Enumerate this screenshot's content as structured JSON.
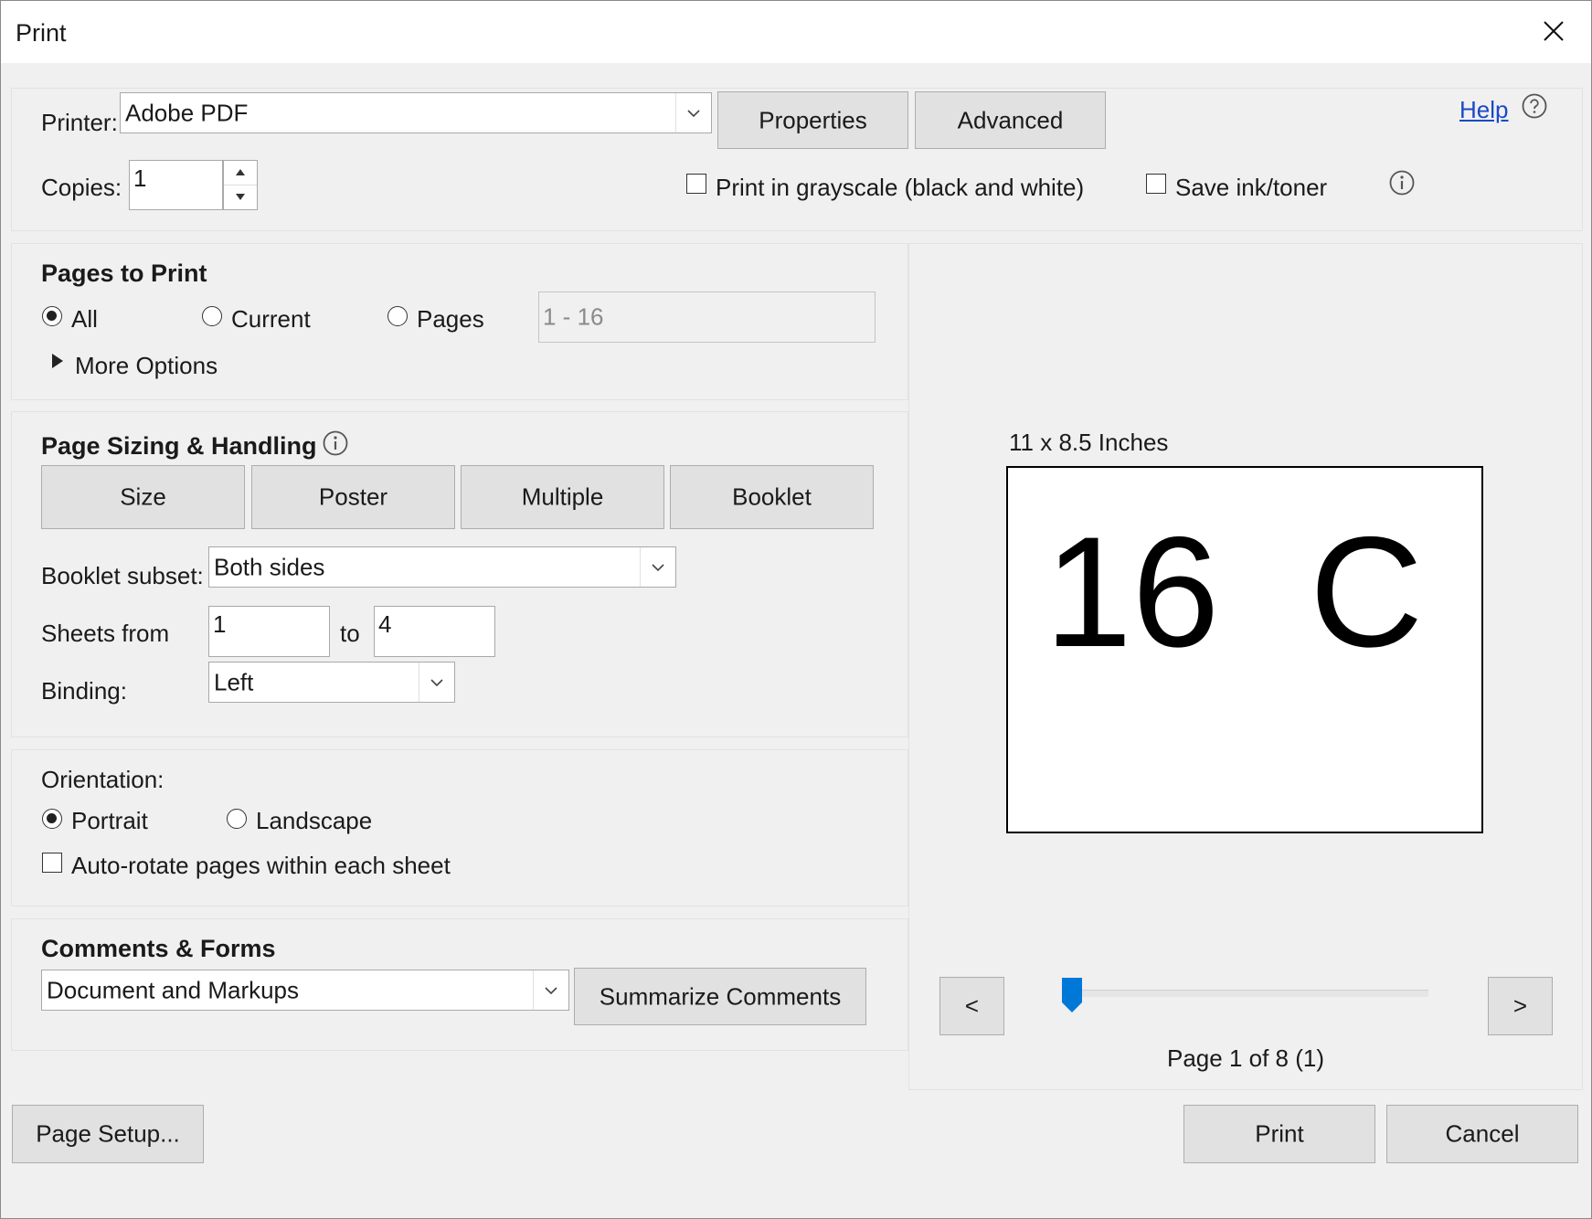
{
  "window": {
    "title": "Print"
  },
  "printer": {
    "label": "Printer:",
    "selected": "Adobe PDF",
    "properties_label": "Properties",
    "advanced_label": "Advanced",
    "help_label": "Help"
  },
  "copies": {
    "label": "Copies:",
    "value": "1"
  },
  "options": {
    "grayscale_label": "Print in grayscale (black and white)",
    "grayscale_checked": false,
    "save_ink_label": "Save ink/toner",
    "save_ink_checked": false
  },
  "pages_to_print": {
    "heading": "Pages to Print",
    "all_label": "All",
    "current_label": "Current",
    "pages_label": "Pages",
    "pages_range_value": "1 - 16",
    "selected": "All",
    "more_options_label": "More Options"
  },
  "page_sizing": {
    "heading": "Page Sizing & Handling",
    "tabs": [
      "Size",
      "Poster",
      "Multiple",
      "Booklet"
    ],
    "selected_tab": "Booklet",
    "booklet_subset_label": "Booklet subset:",
    "booklet_subset_value": "Both sides",
    "sheets_from_label": "Sheets from",
    "sheets_from_value": "1",
    "sheets_to_label": "to",
    "sheets_to_value": "4",
    "binding_label": "Binding:",
    "binding_value": "Left"
  },
  "orientation": {
    "label": "Orientation:",
    "portrait_label": "Portrait",
    "landscape_label": "Landscape",
    "selected": "Portrait",
    "auto_rotate_label": "Auto-rotate pages within each sheet",
    "auto_rotate_checked": false
  },
  "comments_forms": {
    "heading": "Comments & Forms",
    "selected": "Document and Markups",
    "summarize_label": "Summarize Comments"
  },
  "preview": {
    "size_label": "11 x 8.5 Inches",
    "page_left_text": "16",
    "page_right_text": "C",
    "prev_label": "<",
    "next_label": ">",
    "page_status": "Page 1 of 8 (1)",
    "slider_position": 0.0
  },
  "footer": {
    "page_setup_label": "Page Setup...",
    "print_label": "Print",
    "cancel_label": "Cancel"
  },
  "colors": {
    "accent": "#0078d7",
    "link": "#1a49c8",
    "background": "#f0f0f0",
    "button": "#e1e1e1"
  }
}
